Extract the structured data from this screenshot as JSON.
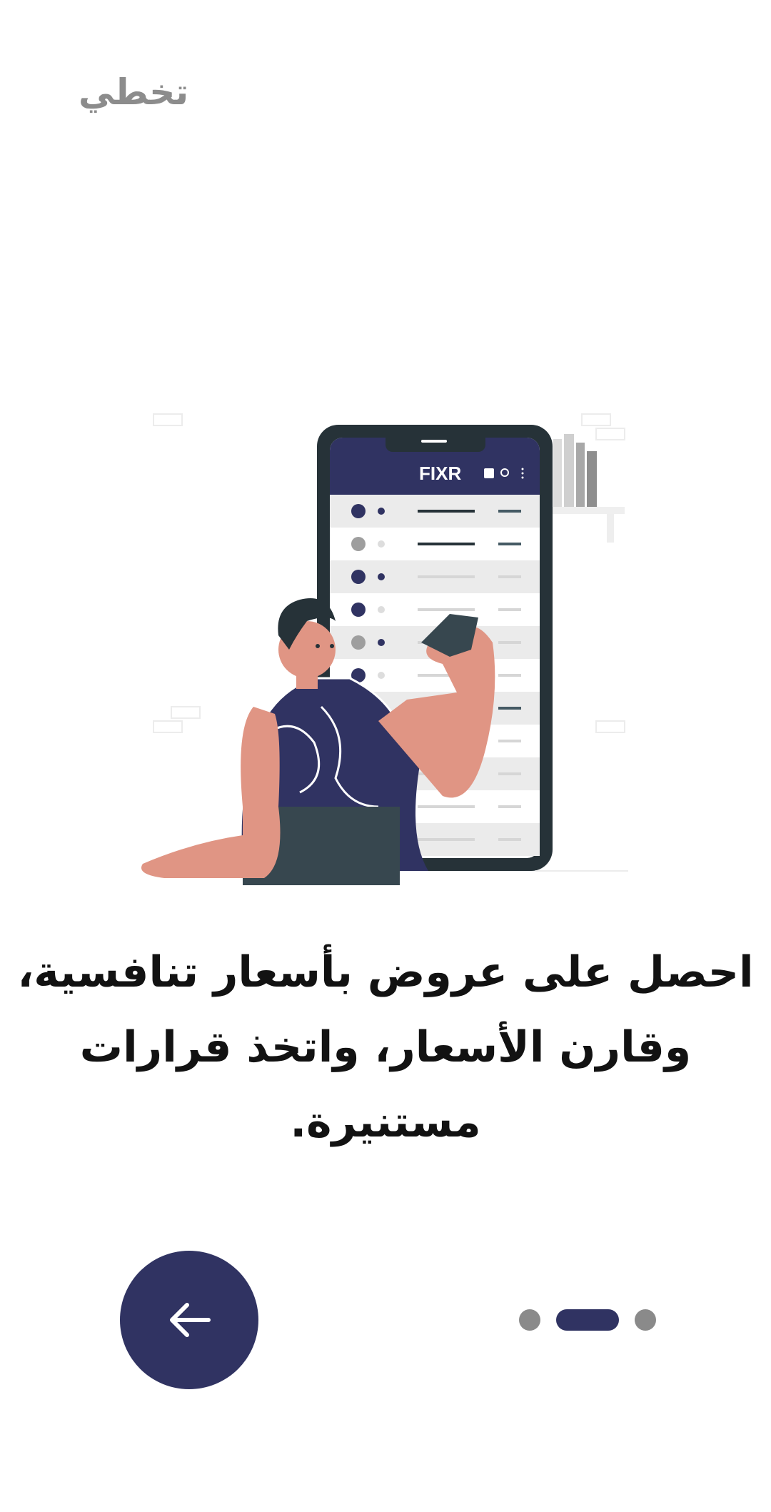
{
  "header": {
    "skip_label": "تخطي"
  },
  "illustration": {
    "description_icon": "person-with-phone-illustration",
    "phone_app_name": "FIXR",
    "phone_rows": 11
  },
  "content": {
    "headline_line1": "احصل على عروض بأسعار تنافسية،",
    "headline_line2": "وقارن الأسعار، واتخذ قرارات مستنيرة."
  },
  "navigation": {
    "back_icon": "arrow-left-icon",
    "page_count": 3,
    "active_page": 2
  },
  "colors": {
    "brand": "#303362",
    "skin": "#e09584",
    "dark": "#263238",
    "muted": "#8a8a8a"
  }
}
